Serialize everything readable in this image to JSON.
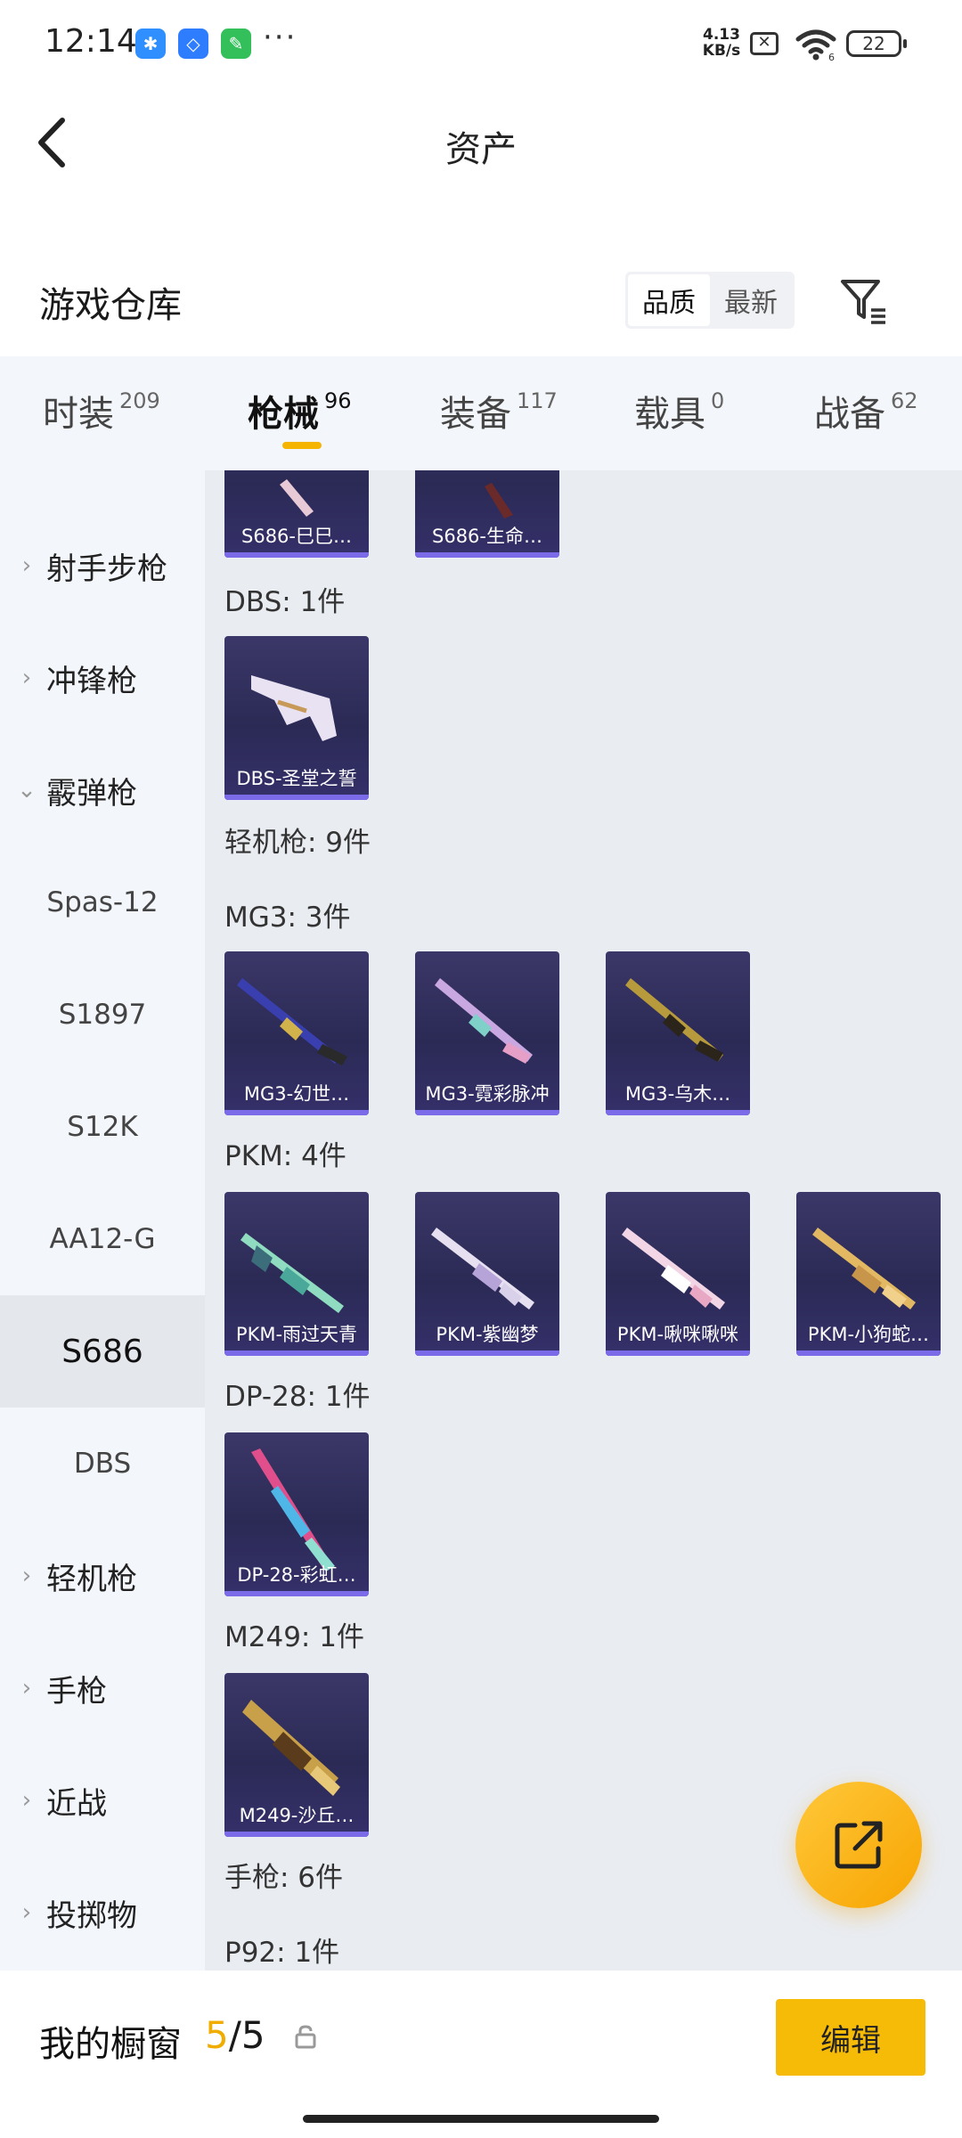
{
  "status_bar": {
    "time": "12:14",
    "net_speed_value": "4.13",
    "net_speed_unit": "KB/s",
    "wifi_badge": "6",
    "battery": "22",
    "overflow": "···"
  },
  "nav": {
    "title": "资产",
    "back_icon": "chevron-left-icon"
  },
  "header": {
    "title": "游戏仓库",
    "sort_options": [
      "品质",
      "最新"
    ],
    "sort_active": "品质",
    "filter_icon": "filter-icon"
  },
  "tabs": [
    {
      "label": "时装",
      "count": "209"
    },
    {
      "label": "枪械",
      "count": "96"
    },
    {
      "label": "装备",
      "count": "117"
    },
    {
      "label": "载具",
      "count": "0"
    },
    {
      "label": "战备",
      "count": "62"
    }
  ],
  "active_tab": "枪械",
  "sidebar": {
    "items": [
      {
        "label": "射手步枪",
        "type": "category"
      },
      {
        "label": "冲锋枪",
        "type": "category"
      },
      {
        "label": "霰弹枪",
        "type": "category",
        "expanded": true
      },
      {
        "label": "Spas-12",
        "type": "sub"
      },
      {
        "label": "S1897",
        "type": "sub"
      },
      {
        "label": "S12K",
        "type": "sub"
      },
      {
        "label": "AA12-G",
        "type": "sub"
      },
      {
        "label": "S686",
        "type": "sub",
        "selected": true
      },
      {
        "label": "DBS",
        "type": "sub"
      },
      {
        "label": "轻机枪",
        "type": "category"
      },
      {
        "label": "手枪",
        "type": "category"
      },
      {
        "label": "近战",
        "type": "category"
      },
      {
        "label": "投掷物",
        "type": "category"
      }
    ]
  },
  "content": {
    "top_cards": [
      "S686-巳巳…",
      "S686-生命…"
    ],
    "labels": {
      "dbs": "DBS: 1件",
      "lmg": "轻机枪: 9件",
      "mg3": "MG3: 3件",
      "pkm": "PKM: 4件",
      "dp28": "DP-28: 1件",
      "m249": "M249: 1件",
      "pistol": "手枪: 6件",
      "p92": "P92: 1件"
    },
    "cards": {
      "dbs": [
        "DBS-圣堂之誓"
      ],
      "mg3": [
        "MG3-幻世…",
        "MG3-霓彩脉冲",
        "MG3-乌木…"
      ],
      "pkm": [
        "PKM-雨过天青",
        "PKM-紫幽梦",
        "PKM-啾咪啾咪",
        "PKM-小狗蛇…"
      ],
      "dp28": [
        "DP-28-彩虹…"
      ],
      "m249": [
        "M249-沙丘…"
      ]
    }
  },
  "fab": {
    "icon": "share-icon"
  },
  "bottom": {
    "label": "我的橱窗",
    "used": "5",
    "sep": "/",
    "total": "5",
    "lock_icon": "lock-icon",
    "edit_label": "编辑"
  },
  "colors": {
    "accent": "#f6bb06",
    "tab_indicator": "#f5b400",
    "card_bg": "#2f2c5c",
    "card_bar": "#7b6be8",
    "content_bg": "#e9ecf1",
    "sidebar_bg": "#f3f6fa"
  }
}
